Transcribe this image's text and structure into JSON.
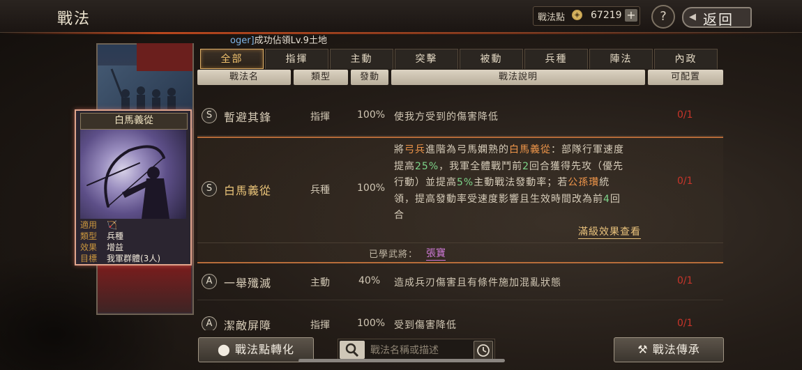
{
  "header": {
    "title": "戰法",
    "points_label": "戰法點",
    "points_value": "67219",
    "plus_label": "+",
    "help_label": "?",
    "back_label": "返回"
  },
  "marquee": {
    "user_fragment": "oger]",
    "text": "成功佔領Lv.9土地"
  },
  "card": {
    "title": "白馬義從",
    "info": [
      {
        "key": "適用",
        "value": ""
      },
      {
        "key": "類型",
        "value": "兵種"
      },
      {
        "key": "效果",
        "value": "增益"
      },
      {
        "key": "目標",
        "value": "我軍群體(3人)"
      }
    ]
  },
  "tabs": [
    "全部",
    "指揮",
    "主動",
    "突擊",
    "被動",
    "兵種",
    "陣法",
    "內政"
  ],
  "active_tab": 0,
  "columns": [
    "戰法名",
    "類型",
    "發動",
    "戰法說明",
    "可配置"
  ],
  "rows": [
    {
      "grade": "S",
      "name": "暫避其鋒",
      "type": "指揮",
      "rate": "100%",
      "desc": "使我方受到的傷害降低",
      "slots": "0/1"
    },
    {
      "grade": "S",
      "name": "白馬義從",
      "type": "兵種",
      "rate": "100%",
      "slots": "0/1",
      "desc_lines": [
        [
          {
            "t": "將"
          },
          {
            "t": "弓兵",
            "c": "o"
          },
          {
            "t": "進階為弓馬嫻熟的"
          },
          {
            "t": "白馬義從",
            "c": "o"
          },
          {
            "t": "：部隊行軍速度"
          }
        ],
        [
          {
            "t": "提高"
          },
          {
            "t": "25%",
            "c": "g"
          },
          {
            "t": "，我軍全體戰鬥前"
          },
          {
            "t": "2",
            "c": "g"
          },
          {
            "t": "回合獲得先攻（優先"
          }
        ],
        [
          {
            "t": "行動）並提高"
          },
          {
            "t": "5%",
            "c": "g"
          },
          {
            "t": "主動戰法發動率；若"
          },
          {
            "t": "公孫瓚",
            "c": "o"
          },
          {
            "t": "統"
          }
        ],
        [
          {
            "t": "領，提高發動率受速度影響且生效時間改為前"
          },
          {
            "t": "4",
            "c": "g"
          },
          {
            "t": "回"
          }
        ],
        [
          {
            "t": "合"
          }
        ]
      ],
      "max_effect_label": "滿級效果查看",
      "learned_label": "已學武將：",
      "learned_general": "張寶"
    },
    {
      "grade": "A",
      "name": "一舉殲滅",
      "type": "主動",
      "rate": "40%",
      "desc": "造成兵刃傷害且有條件施加混亂狀態",
      "slots": "0/1"
    },
    {
      "grade": "A",
      "name": "潔敵屏障",
      "type": "指揮",
      "rate": "100%",
      "desc": "受到傷害降低",
      "slots": "0/1"
    }
  ],
  "footer": {
    "convert_label": "戰法點轉化",
    "search_placeholder": "戰法名稱或描述",
    "inherit_label": "戰法傳承"
  },
  "colors": {
    "accent_orange": "#f0964a",
    "accent_green": "#7ed58a",
    "slot_red": "#c8352a",
    "tab_active": "#f0c16d"
  }
}
